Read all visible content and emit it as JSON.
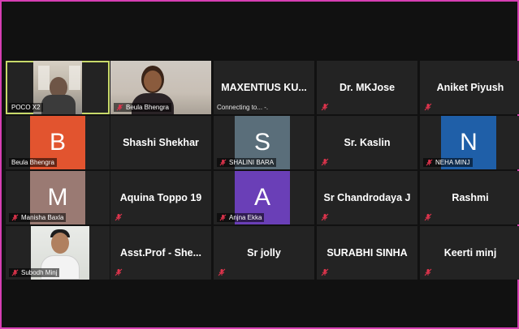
{
  "tiles": [
    {
      "row": 0,
      "col": 0,
      "kind": "video",
      "label": "POCO X2",
      "active": true
    },
    {
      "row": 0,
      "col": 1,
      "kind": "video",
      "label": "Beula Bhengra",
      "muted": true
    },
    {
      "row": 0,
      "col": 2,
      "kind": "name",
      "name": "MAXENTIUS KU...",
      "status": "Connecting to... -."
    },
    {
      "row": 0,
      "col": 3,
      "kind": "name",
      "name": "Dr. MKJose",
      "muted": true
    },
    {
      "row": 0,
      "col": 4,
      "kind": "name",
      "name": "Aniket Piyush",
      "muted": true
    },
    {
      "row": 1,
      "col": 0,
      "kind": "avatar",
      "letter": "B",
      "label": "Beula Bhengra",
      "color": "#e2542f"
    },
    {
      "row": 1,
      "col": 1,
      "kind": "name",
      "name": "Shashi Shekhar"
    },
    {
      "row": 1,
      "col": 2,
      "kind": "avatar",
      "letter": "S",
      "label": "SHALINI BARA",
      "color": "#5a6e7a",
      "muted": true
    },
    {
      "row": 1,
      "col": 3,
      "kind": "name",
      "name": "Sr. Kaslin",
      "muted": true
    },
    {
      "row": 1,
      "col": 4,
      "kind": "avatar",
      "letter": "N",
      "label": "NEHA MINJ",
      "color": "#1f5fa8",
      "muted": true
    },
    {
      "row": 2,
      "col": 0,
      "kind": "avatar",
      "letter": "M",
      "label": "Manisha Baxla",
      "color": "#9a7a73",
      "muted": true
    },
    {
      "row": 2,
      "col": 1,
      "kind": "name",
      "name": "Aquina Toppo 19",
      "muted": true
    },
    {
      "row": 2,
      "col": 2,
      "kind": "avatar",
      "letter": "A",
      "label": "Anjna Ekka",
      "color": "#6a3fb7",
      "muted": true
    },
    {
      "row": 2,
      "col": 3,
      "kind": "name",
      "name": "Sr Chandrodaya J",
      "muted": true
    },
    {
      "row": 2,
      "col": 4,
      "kind": "name",
      "name": "Rashmi",
      "muted": true
    },
    {
      "row": 3,
      "col": 0,
      "kind": "video",
      "label": "Subodh Minj",
      "muted": true
    },
    {
      "row": 3,
      "col": 1,
      "kind": "name",
      "name": "Asst.Prof  -  She...",
      "muted": true
    },
    {
      "row": 3,
      "col": 2,
      "kind": "name",
      "name": "Sr jolly",
      "muted": true
    },
    {
      "row": 3,
      "col": 3,
      "kind": "name",
      "name": "SURABHI SINHA",
      "muted": true
    },
    {
      "row": 3,
      "col": 4,
      "kind": "name",
      "name": "Keerti minj",
      "muted": true
    }
  ],
  "colors": {
    "frame": "#d63fb3",
    "tile_bg": "#232323",
    "active": "#c8d96a",
    "mic_muted": "#e0344d"
  },
  "icons": {
    "mute": "muted-mic-icon"
  }
}
